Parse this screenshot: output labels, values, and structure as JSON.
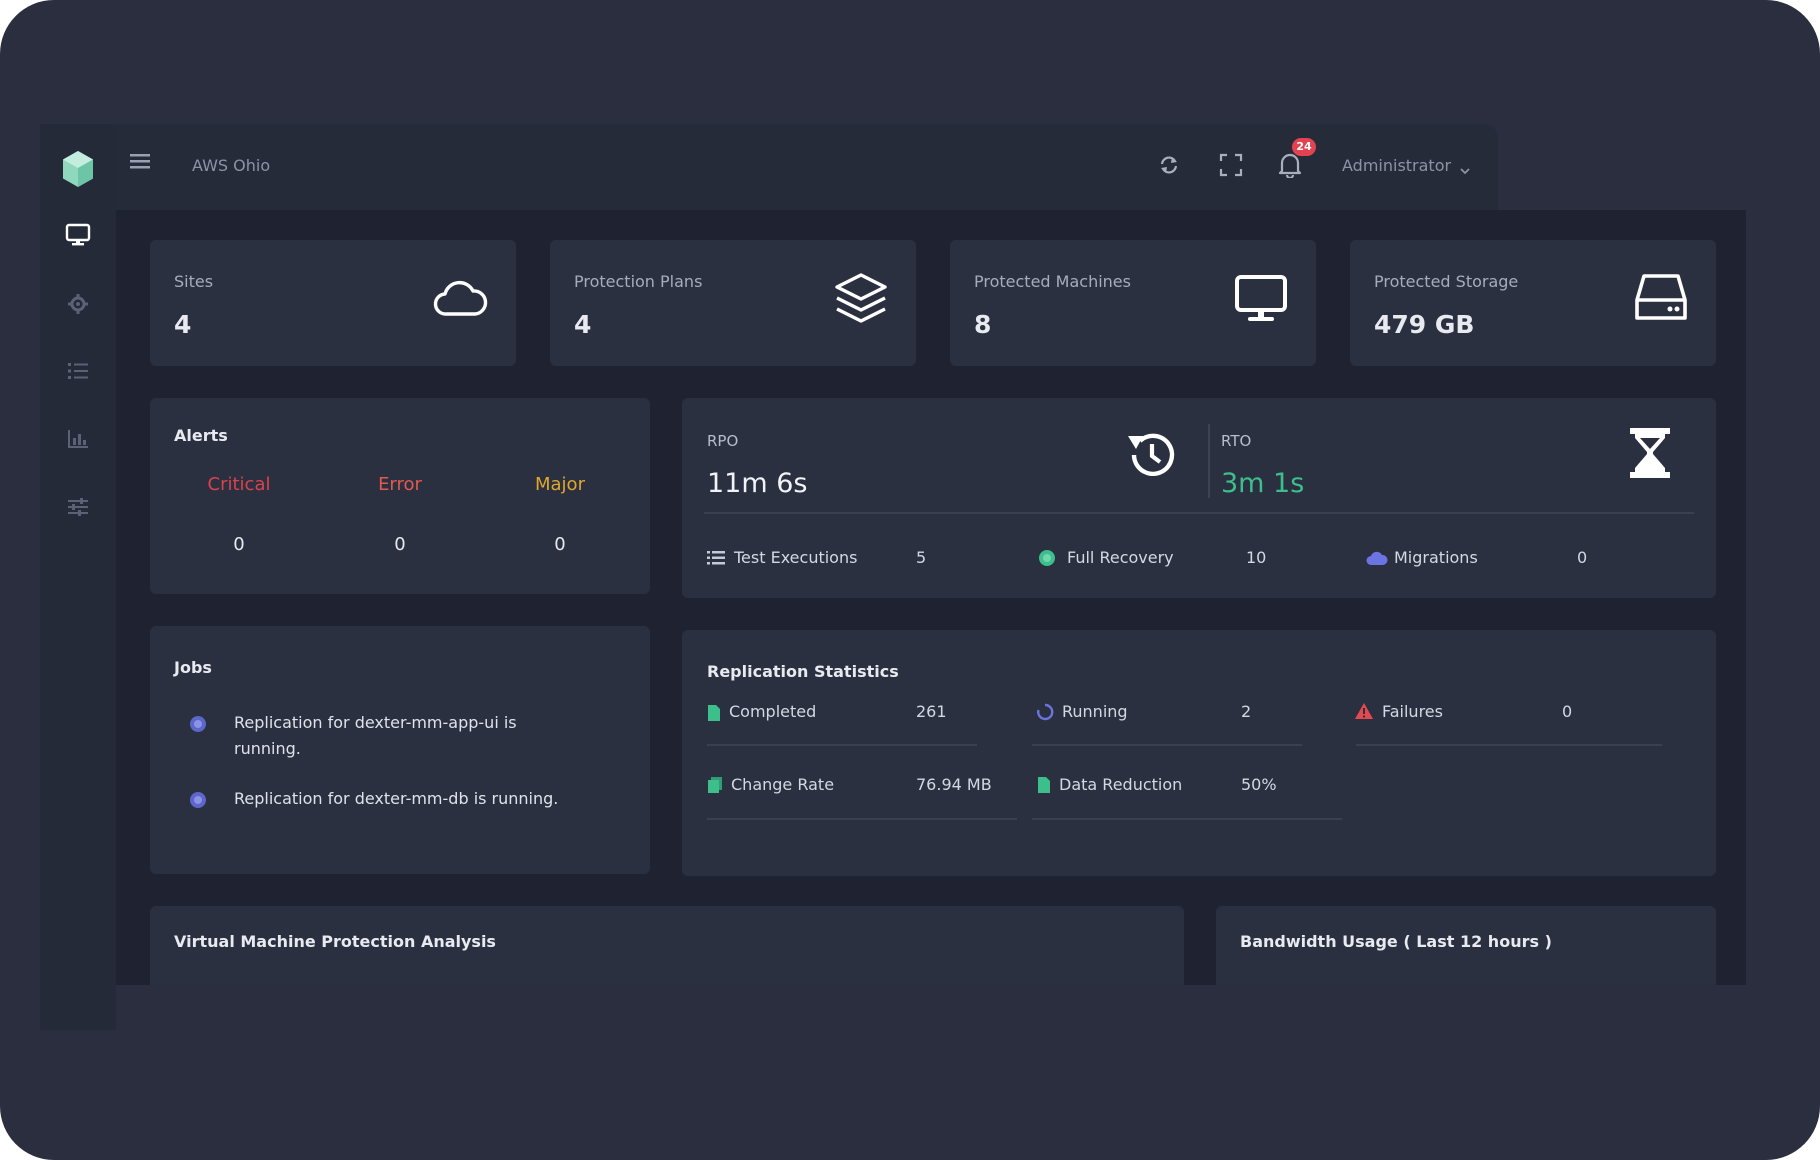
{
  "header": {
    "site_name": "AWS Ohio",
    "notification_count": "24",
    "user_name": "Administrator"
  },
  "sidebar": {
    "items": [
      {
        "icon": "monitor-icon",
        "active": true
      },
      {
        "icon": "gear-icon",
        "active": false
      },
      {
        "icon": "list-icon",
        "active": false
      },
      {
        "icon": "chart-icon",
        "active": false
      },
      {
        "icon": "sliders-icon",
        "active": false
      }
    ]
  },
  "stats": [
    {
      "label": "Sites",
      "value": "4",
      "icon": "cloud-icon"
    },
    {
      "label": "Protection Plans",
      "value": "4",
      "icon": "layers-icon"
    },
    {
      "label": "Protected Machines",
      "value": "8",
      "icon": "monitor-icon"
    },
    {
      "label": "Protected Storage",
      "value": "479 GB",
      "icon": "hard-drive-icon"
    }
  ],
  "alerts": {
    "title": "Alerts",
    "columns": [
      {
        "label": "Critical",
        "value": "0",
        "color": "#d9434c"
      },
      {
        "label": "Error",
        "value": "0",
        "color": "#e05a4f"
      },
      {
        "label": "Major",
        "value": "0",
        "color": "#e0a72e"
      }
    ]
  },
  "recovery": {
    "rpo_label": "RPO",
    "rpo_value": "11m 6s",
    "rto_label": "RTO",
    "rto_value": "3m 1s",
    "rto_color": "#3dbf8c",
    "summary": [
      {
        "label": "Test Executions",
        "value": "5",
        "icon": "list-icon"
      },
      {
        "label": "Full Recovery",
        "value": "10",
        "icon": "check-circle-icon"
      },
      {
        "label": "Migrations",
        "value": "0",
        "icon": "cloud-icon"
      }
    ]
  },
  "jobs": {
    "title": "Jobs",
    "items": [
      {
        "text": "Replication for dexter-mm-app-ui is running."
      },
      {
        "text": "Replication for dexter-mm-db is running."
      }
    ]
  },
  "replication": {
    "title": "Replication Statistics",
    "metrics": [
      {
        "label": "Completed",
        "value": "261",
        "icon": "file-icon"
      },
      {
        "label": "Running",
        "value": "2",
        "icon": "spinner-icon"
      },
      {
        "label": "Failures",
        "value": "0",
        "icon": "warning-icon"
      },
      {
        "label": "Change Rate",
        "value": "76.94 MB",
        "icon": "copy-icon"
      },
      {
        "label": "Data Reduction",
        "value": "50%",
        "icon": "file-icon"
      }
    ]
  },
  "bottom": {
    "vm_title": "Virtual Machine Protection Analysis",
    "bandwidth_title": "Bandwidth Usage ( Last 12 hours )"
  },
  "colors": {
    "accent_green": "#3dbf8c",
    "accent_blue": "#5d67c9",
    "warning": "#e24a4f",
    "background": "#2a2e3e"
  }
}
